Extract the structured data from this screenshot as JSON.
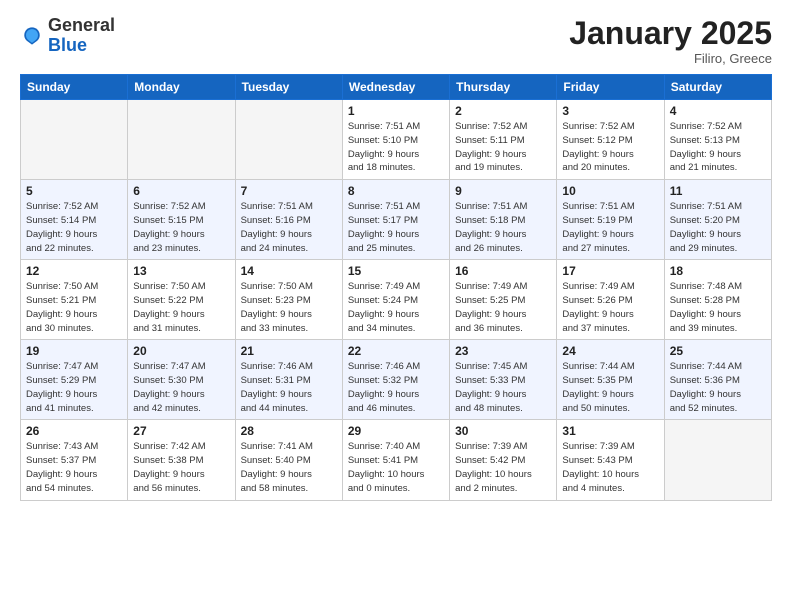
{
  "header": {
    "logo_general": "General",
    "logo_blue": "Blue",
    "month_title": "January 2025",
    "location": "Filiro, Greece"
  },
  "weekdays": [
    "Sunday",
    "Monday",
    "Tuesday",
    "Wednesday",
    "Thursday",
    "Friday",
    "Saturday"
  ],
  "weeks": [
    {
      "alt": false,
      "days": [
        {
          "num": "",
          "info": ""
        },
        {
          "num": "",
          "info": ""
        },
        {
          "num": "",
          "info": ""
        },
        {
          "num": "1",
          "info": "Sunrise: 7:51 AM\nSunset: 5:10 PM\nDaylight: 9 hours\nand 18 minutes."
        },
        {
          "num": "2",
          "info": "Sunrise: 7:52 AM\nSunset: 5:11 PM\nDaylight: 9 hours\nand 19 minutes."
        },
        {
          "num": "3",
          "info": "Sunrise: 7:52 AM\nSunset: 5:12 PM\nDaylight: 9 hours\nand 20 minutes."
        },
        {
          "num": "4",
          "info": "Sunrise: 7:52 AM\nSunset: 5:13 PM\nDaylight: 9 hours\nand 21 minutes."
        }
      ]
    },
    {
      "alt": true,
      "days": [
        {
          "num": "5",
          "info": "Sunrise: 7:52 AM\nSunset: 5:14 PM\nDaylight: 9 hours\nand 22 minutes."
        },
        {
          "num": "6",
          "info": "Sunrise: 7:52 AM\nSunset: 5:15 PM\nDaylight: 9 hours\nand 23 minutes."
        },
        {
          "num": "7",
          "info": "Sunrise: 7:51 AM\nSunset: 5:16 PM\nDaylight: 9 hours\nand 24 minutes."
        },
        {
          "num": "8",
          "info": "Sunrise: 7:51 AM\nSunset: 5:17 PM\nDaylight: 9 hours\nand 25 minutes."
        },
        {
          "num": "9",
          "info": "Sunrise: 7:51 AM\nSunset: 5:18 PM\nDaylight: 9 hours\nand 26 minutes."
        },
        {
          "num": "10",
          "info": "Sunrise: 7:51 AM\nSunset: 5:19 PM\nDaylight: 9 hours\nand 27 minutes."
        },
        {
          "num": "11",
          "info": "Sunrise: 7:51 AM\nSunset: 5:20 PM\nDaylight: 9 hours\nand 29 minutes."
        }
      ]
    },
    {
      "alt": false,
      "days": [
        {
          "num": "12",
          "info": "Sunrise: 7:50 AM\nSunset: 5:21 PM\nDaylight: 9 hours\nand 30 minutes."
        },
        {
          "num": "13",
          "info": "Sunrise: 7:50 AM\nSunset: 5:22 PM\nDaylight: 9 hours\nand 31 minutes."
        },
        {
          "num": "14",
          "info": "Sunrise: 7:50 AM\nSunset: 5:23 PM\nDaylight: 9 hours\nand 33 minutes."
        },
        {
          "num": "15",
          "info": "Sunrise: 7:49 AM\nSunset: 5:24 PM\nDaylight: 9 hours\nand 34 minutes."
        },
        {
          "num": "16",
          "info": "Sunrise: 7:49 AM\nSunset: 5:25 PM\nDaylight: 9 hours\nand 36 minutes."
        },
        {
          "num": "17",
          "info": "Sunrise: 7:49 AM\nSunset: 5:26 PM\nDaylight: 9 hours\nand 37 minutes."
        },
        {
          "num": "18",
          "info": "Sunrise: 7:48 AM\nSunset: 5:28 PM\nDaylight: 9 hours\nand 39 minutes."
        }
      ]
    },
    {
      "alt": true,
      "days": [
        {
          "num": "19",
          "info": "Sunrise: 7:47 AM\nSunset: 5:29 PM\nDaylight: 9 hours\nand 41 minutes."
        },
        {
          "num": "20",
          "info": "Sunrise: 7:47 AM\nSunset: 5:30 PM\nDaylight: 9 hours\nand 42 minutes."
        },
        {
          "num": "21",
          "info": "Sunrise: 7:46 AM\nSunset: 5:31 PM\nDaylight: 9 hours\nand 44 minutes."
        },
        {
          "num": "22",
          "info": "Sunrise: 7:46 AM\nSunset: 5:32 PM\nDaylight: 9 hours\nand 46 minutes."
        },
        {
          "num": "23",
          "info": "Sunrise: 7:45 AM\nSunset: 5:33 PM\nDaylight: 9 hours\nand 48 minutes."
        },
        {
          "num": "24",
          "info": "Sunrise: 7:44 AM\nSunset: 5:35 PM\nDaylight: 9 hours\nand 50 minutes."
        },
        {
          "num": "25",
          "info": "Sunrise: 7:44 AM\nSunset: 5:36 PM\nDaylight: 9 hours\nand 52 minutes."
        }
      ]
    },
    {
      "alt": false,
      "days": [
        {
          "num": "26",
          "info": "Sunrise: 7:43 AM\nSunset: 5:37 PM\nDaylight: 9 hours\nand 54 minutes."
        },
        {
          "num": "27",
          "info": "Sunrise: 7:42 AM\nSunset: 5:38 PM\nDaylight: 9 hours\nand 56 minutes."
        },
        {
          "num": "28",
          "info": "Sunrise: 7:41 AM\nSunset: 5:40 PM\nDaylight: 9 hours\nand 58 minutes."
        },
        {
          "num": "29",
          "info": "Sunrise: 7:40 AM\nSunset: 5:41 PM\nDaylight: 10 hours\nand 0 minutes."
        },
        {
          "num": "30",
          "info": "Sunrise: 7:39 AM\nSunset: 5:42 PM\nDaylight: 10 hours\nand 2 minutes."
        },
        {
          "num": "31",
          "info": "Sunrise: 7:39 AM\nSunset: 5:43 PM\nDaylight: 10 hours\nand 4 minutes."
        },
        {
          "num": "",
          "info": ""
        }
      ]
    }
  ]
}
